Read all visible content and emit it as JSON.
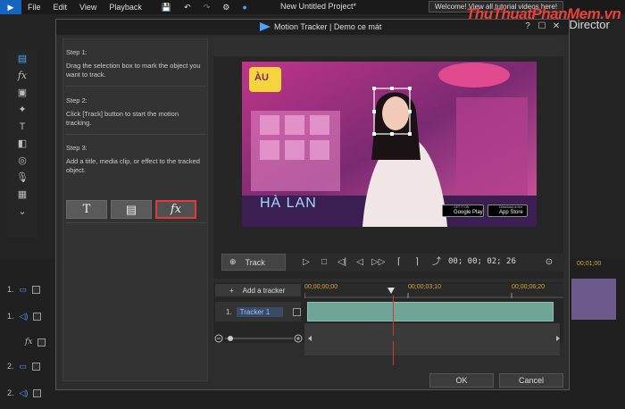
{
  "app": {
    "menu": [
      "File",
      "Edit",
      "View",
      "Playback"
    ],
    "title": "New Untitled Project*",
    "welcome": "Welcome! View all tutorial videos here!",
    "brand": "rDirector",
    "watermark": "ThuThuatPhanMem.vn"
  },
  "background_timeline": {
    "tracks": [
      {
        "label": "1."
      },
      {
        "label": "1."
      },
      {
        "label": "fx"
      },
      {
        "label": "2."
      },
      {
        "label": "2."
      }
    ],
    "right_time": "00;01;00"
  },
  "dialog": {
    "title": "Motion Tracker | Demo ce mát",
    "help": "?",
    "steps": [
      {
        "title": "Step 1:",
        "text": "Drag the selection box to mark the object you want to track."
      },
      {
        "title": "Step 2:",
        "text": "Click [Track] button to start the motion tracking."
      },
      {
        "title": "Step 3:",
        "text": "Add a title, media clip, or effect to the tracked object."
      }
    ],
    "step3_buttons": {
      "title": "T",
      "media": "▤",
      "fx": "fx"
    },
    "video": {
      "logo": "ÀU",
      "name_text": "HÀ LAN",
      "badge_google": "Google Play",
      "badge_google_sub": "GET IT ON",
      "badge_apple": "App Store",
      "badge_apple_sub": "Download on the"
    },
    "controls": {
      "track_label": "Track",
      "timecode": "00; 00; 02; 26"
    },
    "tracker_panel": {
      "add_tracker": "Add a tracker",
      "ruler": [
        "00;00;00;00",
        "00;00;03;10",
        "00;00;06;20"
      ],
      "tracker_index": "1.",
      "tracker_name": "Tracker 1"
    },
    "ok": "OK",
    "cancel": "Cancel"
  },
  "colors": {
    "accent_blue": "#4aa3ff",
    "highlight_red": "#e53935",
    "clip_teal": "#6fa597",
    "ruler_gold": "#d6a63a"
  }
}
